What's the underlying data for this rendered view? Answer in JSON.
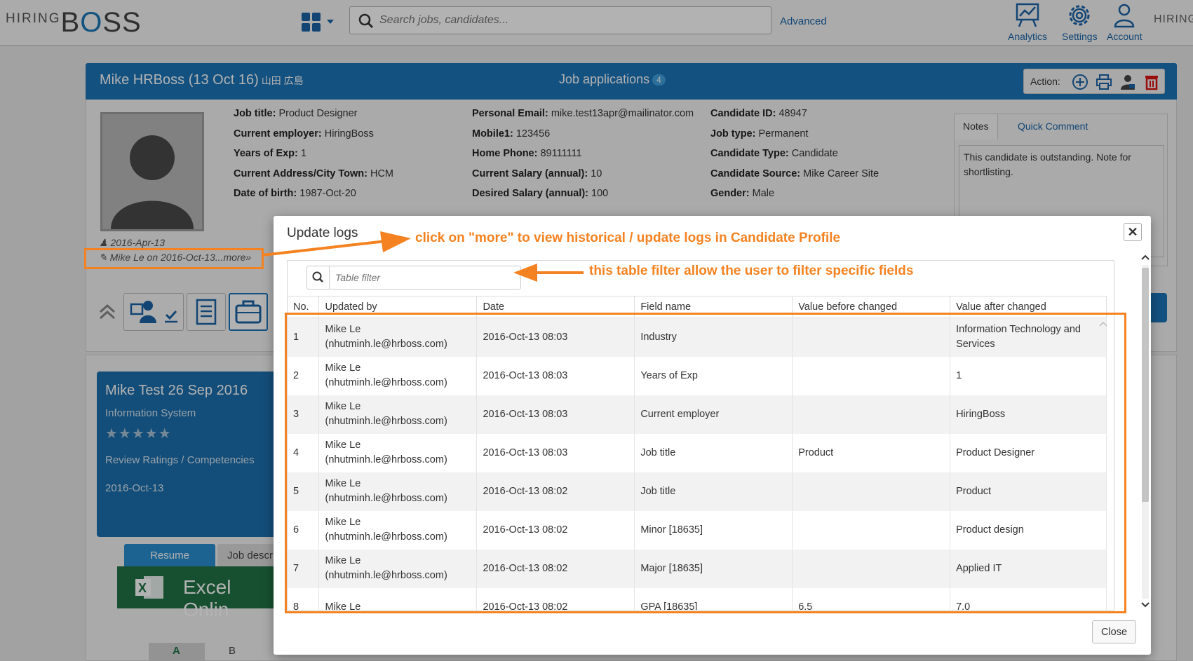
{
  "header": {
    "logo_hiring": "HIRING",
    "logo_b": "B",
    "logo_o": "O",
    "logo_ss": "SS",
    "search_placeholder": "Search jobs, candidates...",
    "advanced": "Advanced",
    "analytics": "Analytics",
    "settings": "Settings",
    "account": "Account",
    "hiring_right": "HIRING"
  },
  "profile": {
    "name": "Mike HRBoss (13 Oct 16)",
    "kanji": "山田 広島",
    "job_apps_label": "Job applications",
    "job_apps_count": "4",
    "action_label": "Action:",
    "col1": [
      {
        "label": "Job title:",
        "value": "Product Designer"
      },
      {
        "label": "Current employer:",
        "value": "HiringBoss"
      },
      {
        "label": "Years of Exp:",
        "value": "1"
      },
      {
        "label": "Current Address/City Town:",
        "value": "HCM"
      },
      {
        "label": "Date of birth:",
        "value": "1987-Oct-20"
      }
    ],
    "col2": [
      {
        "label": "Personal Email:",
        "value": "mike.test13apr@mailinator.com"
      },
      {
        "label": "Mobile1:",
        "value": "123456"
      },
      {
        "label": "Home Phone:",
        "value": "89111111"
      },
      {
        "label": "Current Salary (annual):",
        "value": "10"
      },
      {
        "label": "Desired Salary (annual):",
        "value": "100"
      }
    ],
    "col3": [
      {
        "label": "Candidate ID:",
        "value": "48947"
      },
      {
        "label": "Job type:",
        "value": "Permanent"
      },
      {
        "label": "Candidate Type:",
        "value": "Candidate"
      },
      {
        "label": "Candidate Source:",
        "value": "Mike Career Site"
      },
      {
        "label": "Gender:",
        "value": "Male"
      }
    ],
    "created_date": "2016-Apr-13",
    "more_link": "Mike Le on 2016-Oct-13...more»",
    "notes_tab": "Notes",
    "quick_comment_tab": "Quick Comment",
    "notes_text": "This candidate is outstanding. Note for shortlisting."
  },
  "job_card": {
    "title": "Mike Test 26 Sep 2016",
    "subtitle": "Information System",
    "stars": "★★★★★",
    "review": "Review Ratings / Competencies",
    "date": "2016-Oct-13",
    "tab_resume": "Resume",
    "tab_jobdesc": "Job descr",
    "excel": "Excel Onlin",
    "col_a": "A",
    "col_b": "B"
  },
  "modal": {
    "title": "Update logs",
    "filter_placeholder": "Table filter",
    "columns": [
      "No.",
      "Updated by",
      "Date",
      "Field name",
      "Value before changed",
      "Value after changed"
    ],
    "rows": [
      {
        "no": "1",
        "by1": "Mike Le",
        "by2": "(nhutminh.le@hrboss.com)",
        "date": "2016-Oct-13 08:03",
        "field": "Industry",
        "before": "",
        "after": "Information Technology and Services"
      },
      {
        "no": "2",
        "by1": "Mike Le",
        "by2": "(nhutminh.le@hrboss.com)",
        "date": "2016-Oct-13 08:03",
        "field": "Years of Exp",
        "before": "",
        "after": "1"
      },
      {
        "no": "3",
        "by1": "Mike Le",
        "by2": "(nhutminh.le@hrboss.com)",
        "date": "2016-Oct-13 08:03",
        "field": "Current employer",
        "before": "",
        "after": "HiringBoss"
      },
      {
        "no": "4",
        "by1": "Mike Le",
        "by2": "(nhutminh.le@hrboss.com)",
        "date": "2016-Oct-13 08:03",
        "field": "Job title",
        "before": "Product",
        "after": "Product Designer"
      },
      {
        "no": "5",
        "by1": "Mike Le",
        "by2": "(nhutminh.le@hrboss.com)",
        "date": "2016-Oct-13 08:02",
        "field": "Job title",
        "before": "",
        "after": "Product"
      },
      {
        "no": "6",
        "by1": "Mike Le",
        "by2": "(nhutminh.le@hrboss.com)",
        "date": "2016-Oct-13 08:02",
        "field": "Minor [18635]",
        "before": "",
        "after": "Product design"
      },
      {
        "no": "7",
        "by1": "Mike Le",
        "by2": "(nhutminh.le@hrboss.com)",
        "date": "2016-Oct-13 08:02",
        "field": "Major [18635]",
        "before": "",
        "after": "Applied IT"
      },
      {
        "no": "8",
        "by1": "Mike Le",
        "by2": "",
        "date": "2016-Oct-13 08:02",
        "field": "GPA [18635]",
        "before": "6.5",
        "after": "7.0"
      }
    ],
    "close_label": "Close"
  },
  "annotations": {
    "more_note": "click on \"more\" to view historical / update logs in Candidate Profile",
    "filter_note": "this table filter allow the user to filter specific fields",
    "color": "#f58220"
  },
  "colors": {
    "brand_blue": "#1c75b9",
    "link_blue": "#1a64a6",
    "excel_green": "#217346"
  }
}
